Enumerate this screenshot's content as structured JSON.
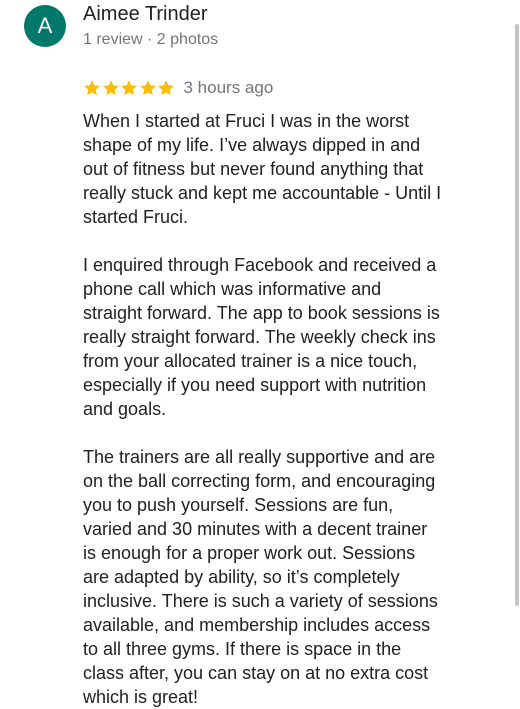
{
  "reviewer": {
    "initial": "A",
    "name": "Aimee Trinder",
    "meta": "1 review · 2 photos",
    "avatar_color": "#00796b"
  },
  "rating": {
    "stars": 5,
    "max_stars": 5,
    "star_color": "#fbbc04",
    "time": "3 hours ago"
  },
  "review": {
    "paragraphs": [
      [
        "When I started at Fruci I was in the worst",
        "shape of my life. I’ve always dipped in and",
        "out of fitness but never found anything that",
        "really stuck and kept me accountable - Until I",
        "started Fruci."
      ],
      [
        "I enquired through Facebook and received a",
        "phone call which was informative and",
        "straight forward. The app to book sessions is",
        "really straight forward. The weekly check ins",
        "from your allocated trainer is a nice touch,",
        "especially if you need support with nutrition",
        "and goals."
      ],
      [
        "The trainers are all really supportive and are",
        "on the ball correcting form, and encouraging",
        "you to push yourself. Sessions are fun,",
        "varied and 30 minutes with a decent trainer",
        "is enough for a proper work out. Sessions",
        "are adapted by ability, so it’s completely",
        "inclusive. There is such a variety of sessions",
        "available, and membership includes access",
        "to all three gyms. If there is space in the",
        "class after, you can stay on at no extra cost",
        "which is great!"
      ]
    ]
  }
}
